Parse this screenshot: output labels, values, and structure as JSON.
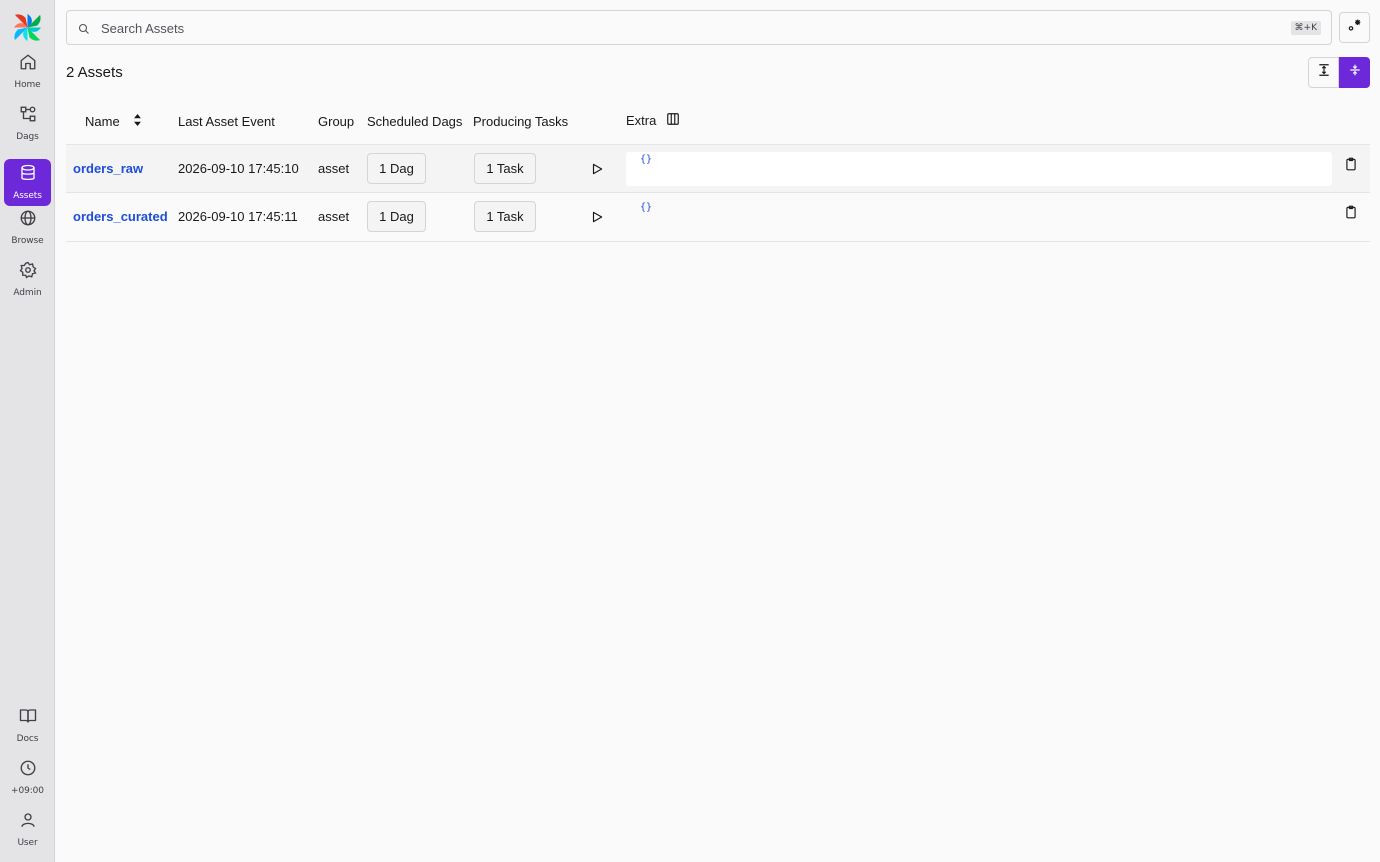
{
  "sidebar": {
    "items": [
      {
        "label": "Home",
        "icon": "home-icon"
      },
      {
        "label": "Dags",
        "icon": "dags-icon"
      },
      {
        "label": "Assets",
        "icon": "database-icon",
        "active": true
      },
      {
        "label": "Browse",
        "icon": "globe-icon"
      },
      {
        "label": "Admin",
        "icon": "gear-icon"
      }
    ],
    "bottom_items": [
      {
        "label": "Docs",
        "icon": "book-icon"
      },
      {
        "label": "+09:00",
        "icon": "clock-icon"
      },
      {
        "label": "User",
        "icon": "user-icon"
      }
    ]
  },
  "search": {
    "placeholder": "Search Assets",
    "shortcut": "⌘+K"
  },
  "header": {
    "count_title": "2 Assets"
  },
  "table": {
    "columns": [
      "Name",
      "Last Asset Event",
      "Group",
      "Scheduled Dags",
      "Producing Tasks",
      "Extra"
    ],
    "rows": [
      {
        "name": "orders_raw",
        "last_event": "2026-09-10 17:45:10",
        "group": "asset",
        "scheduled_dags": "1 Dag",
        "producing_tasks": "1 Task",
        "extra": "{}"
      },
      {
        "name": "orders_curated",
        "last_event": "2026-09-10 17:45:11",
        "group": "asset",
        "scheduled_dags": "1 Dag",
        "producing_tasks": "1 Task",
        "extra": "{}"
      }
    ]
  },
  "colors": {
    "accent": "#6d28d9",
    "link": "#1d4ed8",
    "sidebar_bg": "#e4e4e7"
  }
}
